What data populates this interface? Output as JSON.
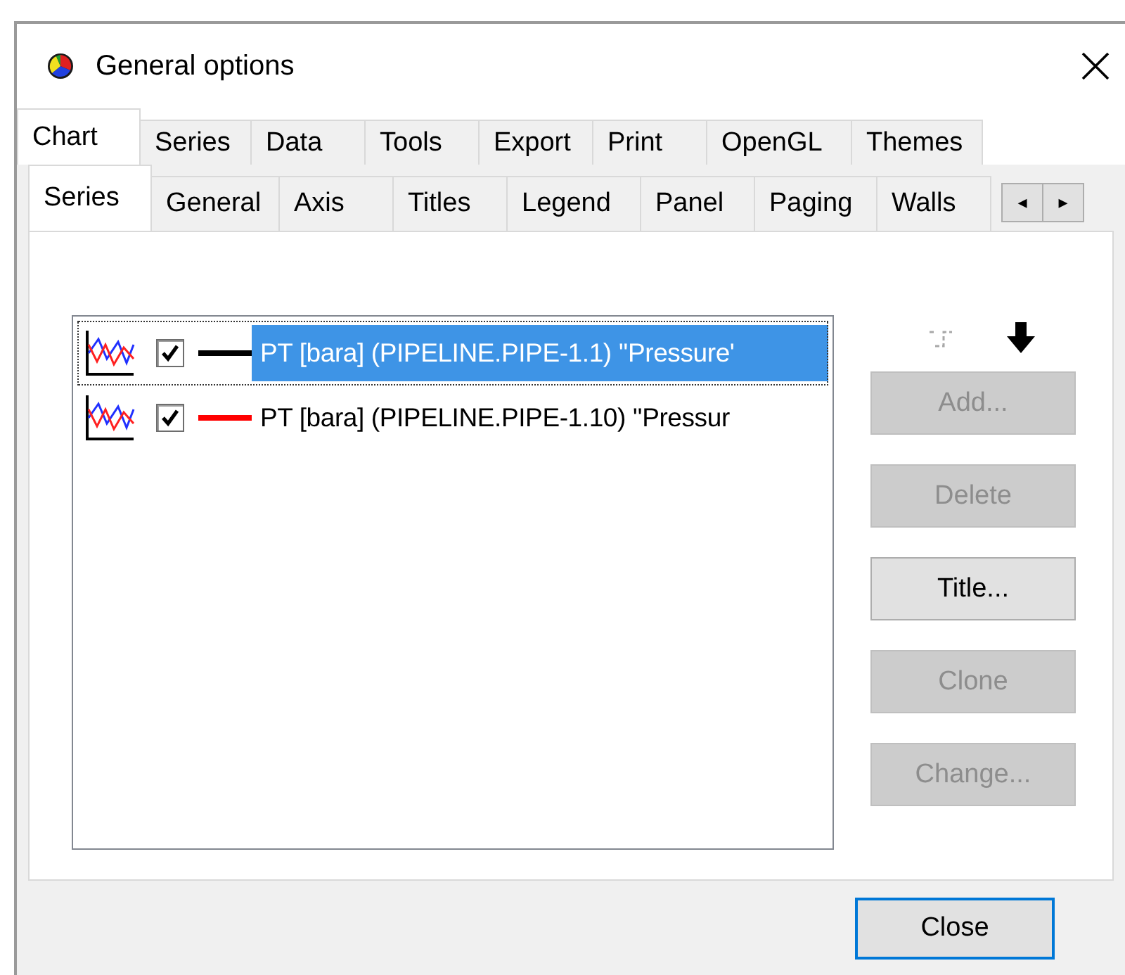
{
  "window": {
    "title": "General options"
  },
  "tabs": [
    {
      "label": "Chart",
      "selected": true
    },
    {
      "label": "Series",
      "selected": false
    },
    {
      "label": "Data",
      "selected": false
    },
    {
      "label": "Tools",
      "selected": false
    },
    {
      "label": "Export",
      "selected": false
    },
    {
      "label": "Print",
      "selected": false
    },
    {
      "label": "OpenGL",
      "selected": false
    },
    {
      "label": "Themes",
      "selected": false
    }
  ],
  "subtabs": [
    {
      "label": "Series",
      "selected": true
    },
    {
      "label": "General",
      "selected": false
    },
    {
      "label": "Axis",
      "selected": false
    },
    {
      "label": "Titles",
      "selected": false
    },
    {
      "label": "Legend",
      "selected": false
    },
    {
      "label": "Panel",
      "selected": false
    },
    {
      "label": "Paging",
      "selected": false
    },
    {
      "label": "Walls",
      "selected": false
    }
  ],
  "tab_scroll": [
    "◂",
    "▸"
  ],
  "series_list": [
    {
      "title": "PT [bara] (PIPELINE.PIPE-1.1) ''Pressure'",
      "checked": true,
      "color": "#000000",
      "selected": true
    },
    {
      "title": "PT [bara] (PIPELINE.PIPE-1.10) ''Pressur",
      "checked": true,
      "color": "#ff0000",
      "selected": false
    }
  ],
  "move_buttons": [
    {
      "kind": "up",
      "disabled": true
    },
    {
      "kind": "down",
      "disabled": false
    }
  ],
  "buttons": [
    {
      "label": "Add...",
      "disabled": true
    },
    {
      "label": "Delete",
      "disabled": true
    },
    {
      "label": "Title...",
      "disabled": false
    },
    {
      "label": "Clone",
      "disabled": true
    },
    {
      "label": "Change...",
      "disabled": true
    }
  ],
  "footer": {
    "close_button": "Close"
  }
}
